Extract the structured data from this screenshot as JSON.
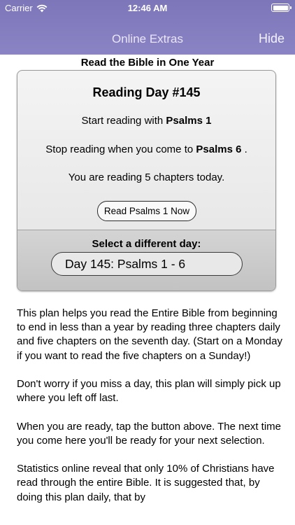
{
  "status_bar": {
    "carrier": "Carrier",
    "time": "12:46 AM"
  },
  "nav": {
    "title": "Online Extras",
    "hide_label": "Hide"
  },
  "page_heading": "Read the Bible in One Year",
  "card": {
    "day_title": "Reading Day #145",
    "start_prefix": "Start reading with ",
    "start_book": "Psalms 1",
    "stop_prefix": "Stop reading when you come to ",
    "stop_book": "Psalms 6",
    "stop_suffix": " .",
    "chapters_text": "You are reading 5 chapters today.",
    "read_button_label": "Read Psalms 1 Now",
    "select_label": "Select a different day:",
    "selected_day": "Day 145: Psalms 1 - 6"
  },
  "paragraphs": [
    "This plan helps you read the Entire Bible from beginning to end in less than a year by reading three chapters daily and five chapters on the seventh day. (Start on a Monday if you want to read the five chapters on a Sunday!)",
    "Don't worry if you miss a day, this plan will simply pick up where you left off last.",
    "When you are ready, tap the button above. The next time you come here you'll be ready for your next selection.",
    "Statistics online reveal that only 10% of Christians have read through the entire Bible. It is suggested that, by doing this plan daily, that by"
  ],
  "colors": {
    "nav_bar": "#8a83c4",
    "card_top": "#eeeeee",
    "card_bottom": "#c8c8c8"
  }
}
